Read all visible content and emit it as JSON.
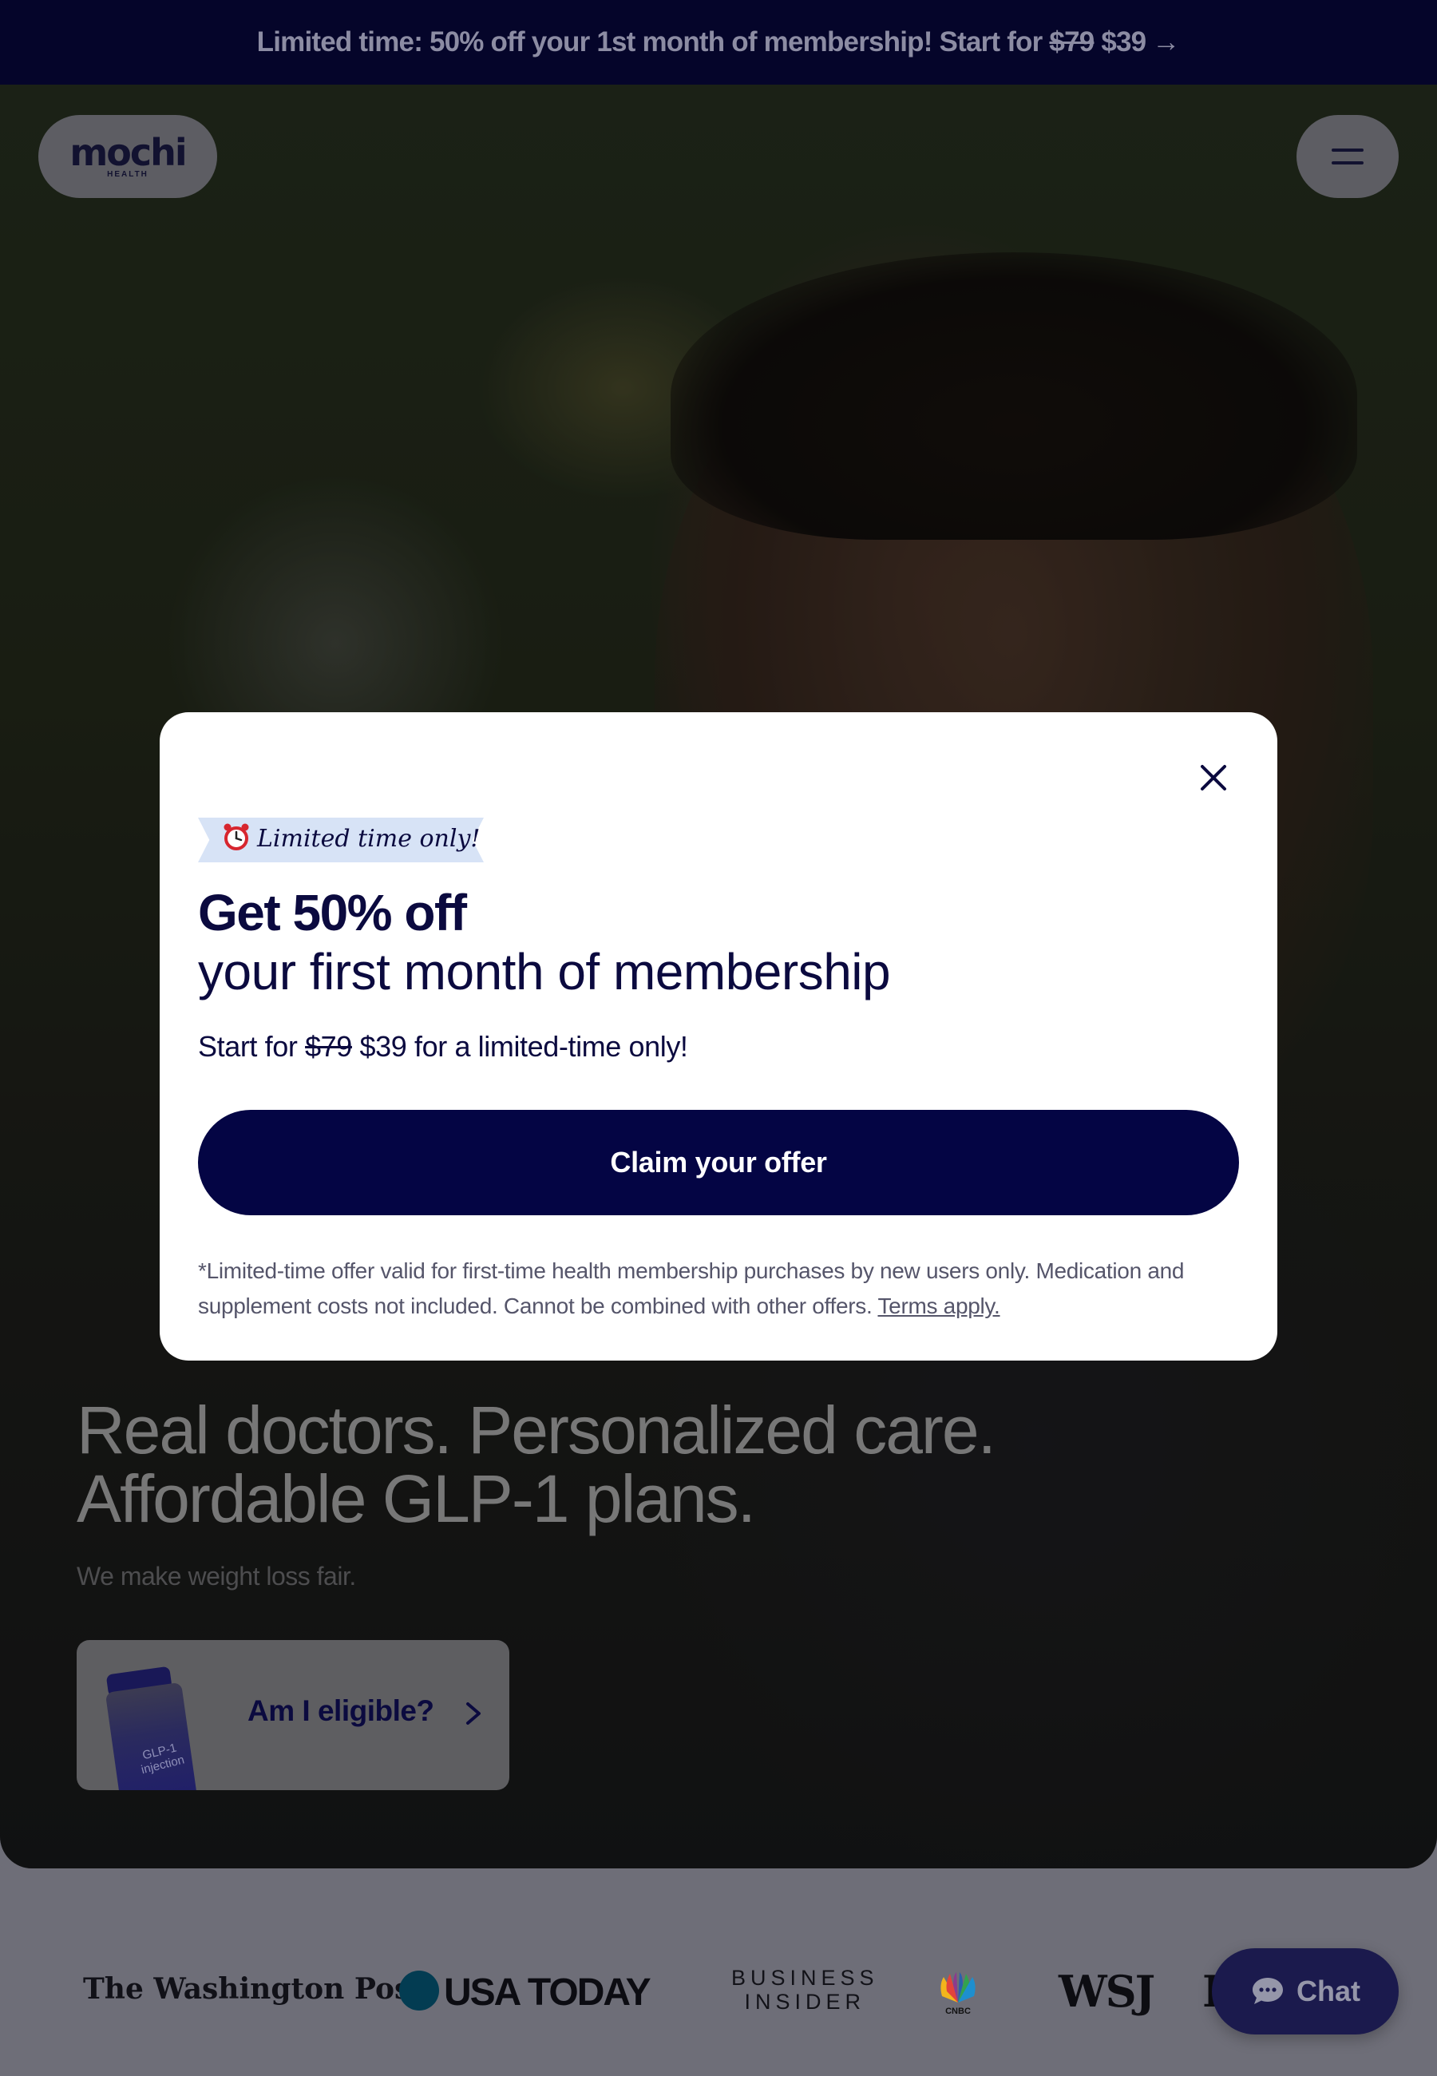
{
  "banner": {
    "text": "Limited time: 50% off your 1st month of membership! Start for",
    "old_price": "$79",
    "new_price": "$39",
    "arrow": "→"
  },
  "header": {
    "logo_word": "mochi",
    "logo_sub": "HEALTH"
  },
  "hero": {
    "headline_line1": "Real doctors. Personalized care.",
    "headline_line2": "Affordable GLP-1 plans.",
    "subhead": "We make weight loss fair.",
    "eligibility_button": "Am I eligible?",
    "vial_label": "GLP-1 injection"
  },
  "press_logos": {
    "washington_post": "The Washington Post",
    "usa_today": "USA TODAY",
    "business_insider_line1": "BUSINESS",
    "business_insider_line2": "INSIDER",
    "cnbc": "CNBC",
    "wsj": "WSJ",
    "cut_off": "F"
  },
  "chat": {
    "label": "Chat"
  },
  "modal": {
    "ribbon": "Limited time only!",
    "title_bold": "Get 50% off",
    "title_regular": "your first month of membership",
    "price_prefix": "Start for",
    "old_price": "$79",
    "new_price": "$39",
    "price_suffix": "for a limited-time only!",
    "cta": "Claim your offer",
    "disclaimer": "*Limited-time offer valid for first-time health membership purchases by new users only. Medication and supplement costs not included. Cannot be combined with other offers.",
    "terms_link": "Terms apply."
  },
  "colors": {
    "navy": "#040544",
    "banner_bg": "#05052a",
    "ribbon_bg": "#d7e3f6",
    "modal_bg": "#ffffff"
  }
}
